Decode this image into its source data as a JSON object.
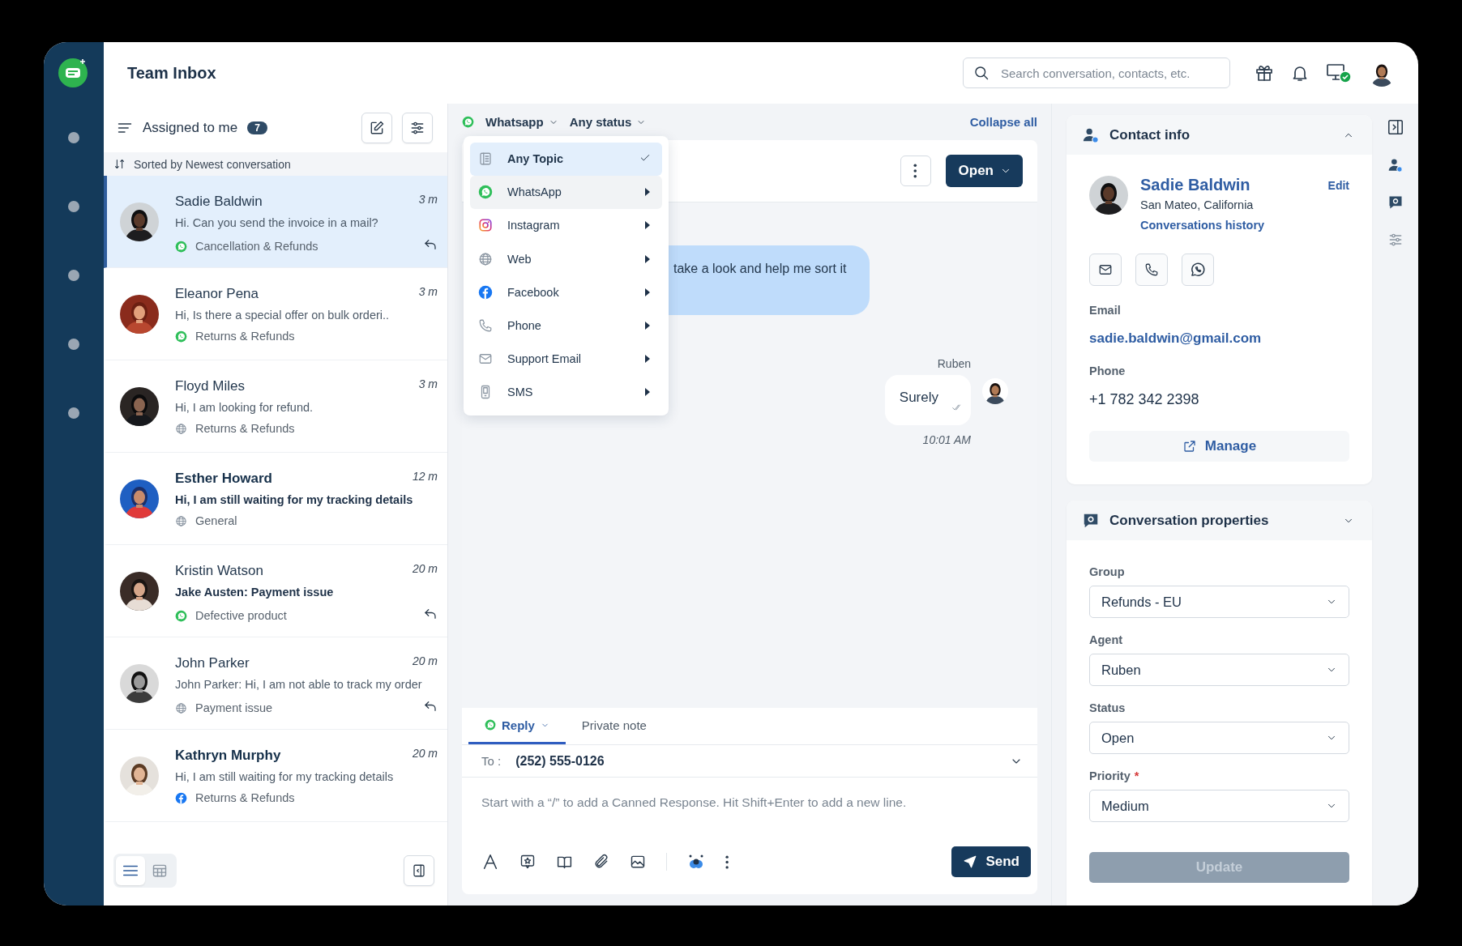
{
  "app": {
    "title": "Team Inbox"
  },
  "search": {
    "placeholder": "Search conversation, contacts, etc."
  },
  "inbox": {
    "view": "Assigned to me",
    "count": "7",
    "sort": "Sorted by Newest conversation",
    "conversations": [
      {
        "name": "Sadie Baldwin",
        "preview": "Hi. Can you send the invoice in a mail?",
        "kind": "whatsapp",
        "topic": "Cancellation & Refunds",
        "time": "3 m",
        "name_bold": false,
        "preview_bold": false,
        "replied": true,
        "selected": true
      },
      {
        "name": "Eleanor Pena",
        "preview": "Hi, Is there a special offer on bulk orderi..",
        "kind": "whatsapp",
        "topic": "Returns & Refunds",
        "time": "3 m",
        "name_bold": false,
        "preview_bold": false,
        "replied": false,
        "selected": false
      },
      {
        "name": "Floyd Miles",
        "preview": "Hi, I am looking for refund.",
        "kind": "web",
        "topic": "Returns & Refunds",
        "time": "3 m",
        "name_bold": false,
        "preview_bold": false,
        "replied": false,
        "selected": false
      },
      {
        "name": "Esther Howard",
        "preview": "Hi, I am still waiting for my tracking details",
        "kind": "web",
        "topic": "General",
        "time": "12 m",
        "name_bold": true,
        "preview_bold": true,
        "replied": false,
        "selected": false
      },
      {
        "name": "Kristin Watson",
        "preview": "Jake Austen: Payment issue",
        "kind": "whatsapp",
        "topic": "Defective product",
        "time": "20 m",
        "name_bold": false,
        "preview_bold": true,
        "replied": true,
        "selected": false
      },
      {
        "name": "John Parker",
        "preview": "John Parker: Hi, I am not able to track my order",
        "kind": "web",
        "topic": "Payment issue",
        "time": "20 m",
        "name_bold": false,
        "preview_bold": false,
        "replied": true,
        "selected": false
      },
      {
        "name": "Kathryn Murphy",
        "preview": "Hi, I am still waiting for my tracking details",
        "kind": "facebook",
        "topic": "Returns & Refunds",
        "time": "20 m",
        "name_bold": true,
        "preview_bold": false,
        "replied": false,
        "selected": false
      }
    ],
    "view_modes": [
      {
        "kind": "list",
        "selected": true
      },
      {
        "kind": "grid",
        "selected": false
      }
    ]
  },
  "filters": {
    "channel": "Whatsapp",
    "status": "Any status",
    "collapse": "Collapse all"
  },
  "topic_menu": [
    {
      "label": "Any Topic",
      "kind": "topic",
      "selected": true,
      "hovered": false,
      "submenu": false
    },
    {
      "label": "WhatsApp",
      "kind": "whatsapp",
      "selected": false,
      "hovered": true,
      "submenu": true
    },
    {
      "label": "Instagram",
      "kind": "instagram",
      "selected": false,
      "hovered": false,
      "submenu": true
    },
    {
      "label": "Web",
      "kind": "web",
      "selected": false,
      "hovered": false,
      "submenu": true
    },
    {
      "label": "Facebook",
      "kind": "facebook",
      "selected": false,
      "hovered": false,
      "submenu": true
    },
    {
      "label": "Phone",
      "kind": "phone",
      "selected": false,
      "hovered": false,
      "submenu": true
    },
    {
      "label": "Support Email",
      "kind": "email",
      "selected": false,
      "hovered": false,
      "submenu": true
    },
    {
      "label": "SMS",
      "kind": "sms",
      "selected": false,
      "hovered": false,
      "submenu": true
    }
  ],
  "chat": {
    "status_button": "Open",
    "messages": [
      {
        "kind": "incoming",
        "text": "take a look and help me sort it"
      },
      {
        "kind": "outgoing",
        "sender": "Ruben",
        "text": "Surely",
        "time": "10:01 AM"
      }
    ]
  },
  "composer": {
    "tabs": [
      {
        "label": "Reply",
        "selected": true
      },
      {
        "label": "Private note",
        "selected": false
      }
    ],
    "to_label": "To :",
    "to": "(252) 555-0126",
    "placeholder": "Start with a “/” to add a Canned Response. Hit Shift+Enter to add a new line.",
    "send": "Send"
  },
  "contact": {
    "title": "Contact info",
    "name": "Sadie Baldwin",
    "edit": "Edit",
    "location": "San Mateo, California",
    "history": "Conversations history",
    "email_label": "Email",
    "email": "sadie.baldwin@gmail.com",
    "phone_label": "Phone",
    "phone": "+1 782 342 2398",
    "manage": "Manage"
  },
  "properties": {
    "title": "Conversation properties",
    "fields": [
      {
        "label": "Group",
        "value": "Refunds - EU"
      },
      {
        "label": "Agent",
        "value": "Ruben"
      },
      {
        "label": "Status",
        "value": "Open"
      },
      {
        "label": "Priority",
        "value": "Medium",
        "required_mark": "*"
      }
    ],
    "update": {
      "label": "Update",
      "disabled": true
    }
  }
}
